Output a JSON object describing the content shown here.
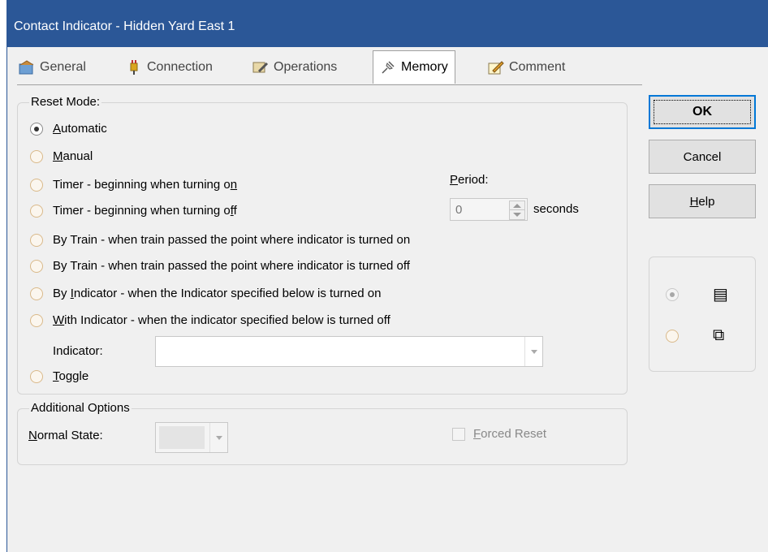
{
  "window": {
    "title": "Contact Indicator - Hidden Yard East 1"
  },
  "tabs": [
    {
      "label": "General",
      "icon": "general-icon"
    },
    {
      "label": "Connection",
      "icon": "plug-icon"
    },
    {
      "label": "Operations",
      "icon": "operations-icon"
    },
    {
      "label": "Memory",
      "icon": "pin-icon",
      "active": true
    },
    {
      "label": "Comment",
      "icon": "pencil-note-icon"
    }
  ],
  "reset_mode": {
    "label": "Reset Mode:",
    "options": [
      {
        "pre": "",
        "u": "A",
        "post": "utomatic",
        "checked": true
      },
      {
        "pre": "",
        "u": "M",
        "post": "anual",
        "checked": false
      },
      {
        "pre": "Timer - beginning when turning o",
        "u": "n",
        "post": "",
        "checked": false
      },
      {
        "pre": "Timer - beginning when turning o",
        "u": "f",
        "post": "f",
        "checked": false
      },
      {
        "pre": "By Train - when train passed the point where indicator is turned on",
        "u": "",
        "post": "",
        "checked": false
      },
      {
        "pre": "By Train - when train passed the point where indicator is turned off",
        "u": "",
        "post": "",
        "checked": false
      },
      {
        "pre": "By ",
        "u": "I",
        "post": "ndicator - when the Indicator specified below is turned on",
        "checked": false
      },
      {
        "pre": "",
        "u": "W",
        "post": "ith Indicator - when the indicator specified below is turned off",
        "checked": false
      },
      {
        "pre": "",
        "u": "T",
        "post": "oggle",
        "checked": false
      }
    ],
    "period": {
      "label_u": "P",
      "label_rest": "eriod:",
      "value": "0",
      "unit": "seconds"
    },
    "indicator": {
      "label": "Indicator:",
      "value": ""
    }
  },
  "additional_options": {
    "label": "Additional Options",
    "normal_state": {
      "label_u": "N",
      "label_rest": "ormal State:",
      "value": ""
    },
    "forced_reset": {
      "label_u": "F",
      "label_rest": "orced Reset",
      "checked": false
    }
  },
  "buttons": {
    "ok": "OK",
    "cancel": "Cancel",
    "help_u": "H",
    "help_rest": "elp"
  },
  "view_options": [
    {
      "icon": "list-view-icon",
      "symbol": "▤",
      "checked": true
    },
    {
      "icon": "cascade-view-icon",
      "symbol": "⧉",
      "checked": false
    }
  ],
  "colors": {
    "titlebar": "#2b5797",
    "default_button_border": "#0078d7"
  }
}
